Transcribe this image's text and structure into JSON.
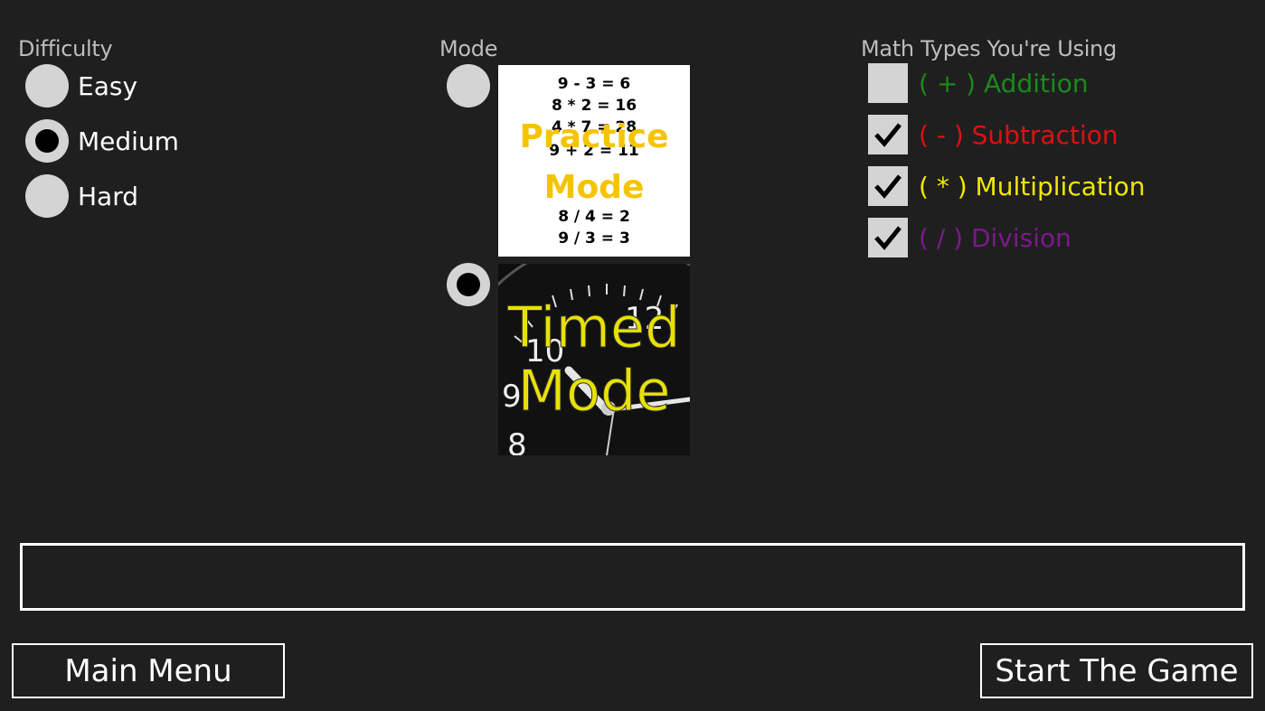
{
  "difficulty": {
    "heading": "Difficulty",
    "options": [
      {
        "label": "Easy",
        "selected": false
      },
      {
        "label": "Medium",
        "selected": true
      },
      {
        "label": "Hard",
        "selected": false
      }
    ]
  },
  "mode": {
    "heading": "Mode",
    "practice": {
      "selected": false,
      "title_line1": "Practice",
      "title_line2": "Mode",
      "equations": [
        "9 - 3 = 6",
        "8 * 2 = 16",
        "4 * 7 = 28",
        "9 + 2 = 11",
        "8 / 4 = 2",
        "9 / 3 = 3"
      ]
    },
    "timed": {
      "selected": true,
      "title_line1": "Timed",
      "title_line2": "Mode",
      "clock_numbers": [
        "12",
        "10",
        "9",
        "8"
      ]
    }
  },
  "math_types": {
    "heading": "Math Types You're Using",
    "items": [
      {
        "label": "( + ) Addition",
        "checked": false,
        "color": "#1a8a1a"
      },
      {
        "label": "( - ) Subtraction",
        "checked": true,
        "color": "#e01010"
      },
      {
        "label": "( * ) Multiplication",
        "checked": true,
        "color": "#f0e800"
      },
      {
        "label": "( / ) Division",
        "checked": true,
        "color": "#7a1a8a"
      }
    ]
  },
  "message": "",
  "buttons": {
    "main_menu": "Main Menu",
    "start": "Start The Game"
  }
}
